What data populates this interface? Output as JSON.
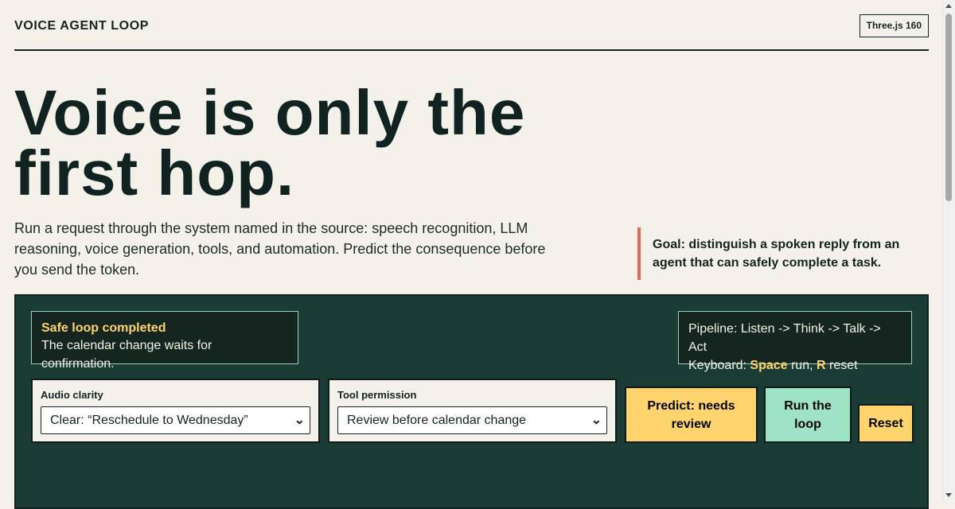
{
  "header": {
    "brand": "VOICE AGENT LOOP",
    "version_badge": "Three.js 160"
  },
  "hero": {
    "title": "Voice is only the first hop.",
    "lede": "Run a request through the system named in the source: speech recognition, LLM reasoning, voice generation, tools, and automation. Predict the consequence before you send the token.",
    "goal": "Goal: distinguish a spoken reply from an agent that can safely complete a task."
  },
  "stage": {
    "status": {
      "title": "Safe loop completed",
      "body": "The calendar change waits for confirmation."
    },
    "info": {
      "pipeline": "Pipeline: Listen -> Think -> Talk -> Act",
      "keyboard_prefix": "Keyboard: ",
      "key_space": "Space",
      "run_text": " run, ",
      "key_r": "R",
      "reset_text": " reset"
    },
    "audio_clarity": {
      "label": "Audio clarity",
      "value": "Clear: “Reschedule to Wednesday”"
    },
    "tool_permission": {
      "label": "Tool permission",
      "value": "Review before calendar change"
    },
    "buttons": {
      "predict": "Predict: needs review",
      "run": "Run the loop",
      "reset": "Reset"
    }
  },
  "colors": {
    "background": "#f4f1ea",
    "stage": "#1b3c35",
    "accent_yellow": "#ffd36d",
    "accent_mint": "#9fe3c6",
    "goal_rule": "#e0684d"
  },
  "icons": {
    "select_arrow": "chevron-down-icon"
  }
}
